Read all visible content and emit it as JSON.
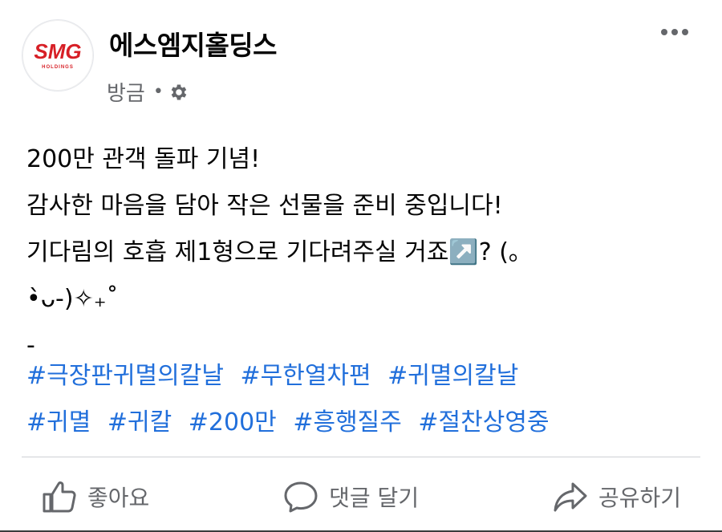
{
  "header": {
    "page_name": "에스엠지홀딩스",
    "timestamp": "방금",
    "separator": "•",
    "avatar_logo_text": "SMG",
    "avatar_logo_subtext": "HOLDINGS",
    "privacy_icon": "gear-icon",
    "more_icon": "more-horizontal-icon"
  },
  "post": {
    "lines": [
      "200만 관객 돌파 기념!",
      "감사한 마음을 담아 작은 선물을 준비 중입니다!",
      "기다림의 호흡 제1형으로 기다려주실 거죠↗️? (｡",
      "•̀ᴗ-)✧₊˚",
      "-"
    ],
    "hashtags": [
      [
        "#극장판귀멸의칼날",
        "#무한열차편",
        "#귀멸의칼날"
      ],
      [
        "#귀멸",
        "#귀칼",
        "#200만",
        "#흥행질주",
        "#절찬상영중"
      ]
    ]
  },
  "actions": {
    "like_label": "좋아요",
    "comment_label": "댓글 달기",
    "share_label": "공유하기"
  },
  "colors": {
    "hashtag": "#216fdb",
    "secondary_text": "#65676b",
    "brand_red": "#d71f26"
  }
}
